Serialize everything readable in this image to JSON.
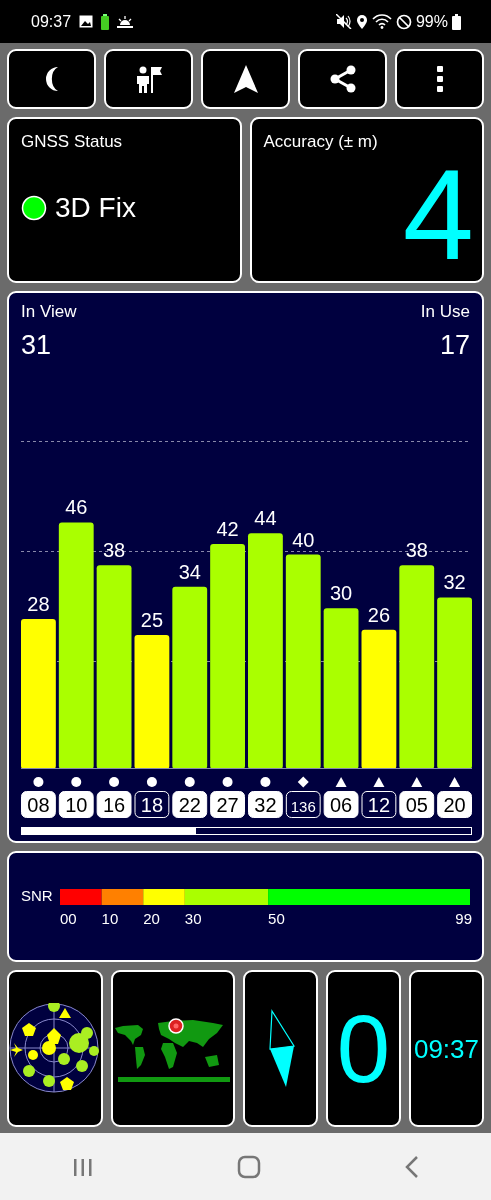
{
  "status_bar": {
    "time": "09:37",
    "battery": "99%"
  },
  "toolbar": [
    {
      "kind": "moon"
    },
    {
      "kind": "person-flag"
    },
    {
      "kind": "arrow"
    },
    {
      "kind": "share"
    },
    {
      "kind": "more"
    }
  ],
  "gnss_status": {
    "title": "GNSS Status",
    "value": "3D Fix",
    "color": "#00ff00"
  },
  "accuracy": {
    "title": "Accuracy (± m)",
    "value": "4"
  },
  "satellites_panel": {
    "in_view_label": "In View",
    "in_view": "31",
    "in_use_label": "In Use",
    "in_use": "17",
    "chart_data": {
      "type": "bar",
      "categories": [
        "08",
        "10",
        "16",
        "18",
        "22",
        "27",
        "32",
        "136",
        "06",
        "12",
        "05",
        "20"
      ],
      "values": [
        28,
        46,
        38,
        25,
        34,
        42,
        44,
        40,
        30,
        26,
        38,
        32
      ],
      "data_labels": true
    },
    "satellites": [
      {
        "used": true,
        "kind": "circle"
      },
      {
        "used": true,
        "kind": "circle"
      },
      {
        "used": true,
        "kind": "circle"
      },
      {
        "used": false,
        "kind": "circle"
      },
      {
        "used": true,
        "kind": "circle"
      },
      {
        "used": true,
        "kind": "circle"
      },
      {
        "used": true,
        "kind": "circle"
      },
      {
        "used": false,
        "kind": "diamond"
      },
      {
        "used": true,
        "kind": "triangle"
      },
      {
        "used": false,
        "kind": "triangle"
      },
      {
        "used": true,
        "kind": "triangle"
      },
      {
        "used": true,
        "kind": "triangle"
      }
    ]
  },
  "snr_legend": {
    "label": "SNR",
    "ticks": [
      "00",
      "10",
      "20",
      "30",
      "50",
      "99"
    ],
    "segments": [
      {
        "color": "#ff0000"
      },
      {
        "color": "#ff8000"
      },
      {
        "color": "#ffff00"
      },
      {
        "color": "#aaff00"
      },
      {
        "color": "#00ff00"
      }
    ]
  },
  "tiles": [
    {
      "kind": "skyplot"
    },
    {
      "kind": "world-map"
    },
    {
      "kind": "compass"
    },
    {
      "kind": "speed",
      "value": "0"
    },
    {
      "kind": "clock",
      "value": "09:37"
    }
  ]
}
